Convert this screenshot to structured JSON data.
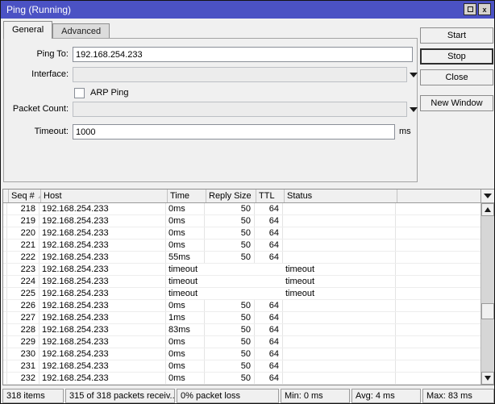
{
  "colors": {
    "titlebar_bg": "#4b52c4",
    "titlebar_text": "#ffffff",
    "window_bg": "#f0f0f0"
  },
  "titlebar": {
    "title": "Ping (Running)"
  },
  "tabs": {
    "general": "General",
    "advanced": "Advanced"
  },
  "form": {
    "ping_to_label": "Ping To:",
    "ping_to_value": "192.168.254.233",
    "interface_label": "Interface:",
    "interface_value": "",
    "arp_ping_label": "ARP Ping",
    "arp_ping_checked": false,
    "packet_count_label": "Packet Count:",
    "packet_count_value": "",
    "timeout_label": "Timeout:",
    "timeout_value": "1000",
    "timeout_unit": "ms"
  },
  "actions": {
    "start": "Start",
    "stop": "Stop",
    "close": "Close",
    "new_window": "New Window"
  },
  "table": {
    "columns": {
      "seq": "Seq #",
      "host": "Host",
      "time": "Time",
      "reply_size": "Reply Size",
      "ttl": "TTL",
      "status": "Status"
    },
    "rows": [
      {
        "seq": "218",
        "host": "192.168.254.233",
        "time": "0ms",
        "reply_size": "50",
        "ttl": "64",
        "status": ""
      },
      {
        "seq": "219",
        "host": "192.168.254.233",
        "time": "0ms",
        "reply_size": "50",
        "ttl": "64",
        "status": ""
      },
      {
        "seq": "220",
        "host": "192.168.254.233",
        "time": "0ms",
        "reply_size": "50",
        "ttl": "64",
        "status": ""
      },
      {
        "seq": "221",
        "host": "192.168.254.233",
        "time": "0ms",
        "reply_size": "50",
        "ttl": "64",
        "status": ""
      },
      {
        "seq": "222",
        "host": "192.168.254.233",
        "time": "55ms",
        "reply_size": "50",
        "ttl": "64",
        "status": ""
      },
      {
        "seq": "223",
        "host": "192.168.254.233",
        "time": "timeout",
        "reply_size": "",
        "ttl": "",
        "status": "timeout"
      },
      {
        "seq": "224",
        "host": "192.168.254.233",
        "time": "timeout",
        "reply_size": "",
        "ttl": "",
        "status": "timeout"
      },
      {
        "seq": "225",
        "host": "192.168.254.233",
        "time": "timeout",
        "reply_size": "",
        "ttl": "",
        "status": "timeout"
      },
      {
        "seq": "226",
        "host": "192.168.254.233",
        "time": "0ms",
        "reply_size": "50",
        "ttl": "64",
        "status": ""
      },
      {
        "seq": "227",
        "host": "192.168.254.233",
        "time": "1ms",
        "reply_size": "50",
        "ttl": "64",
        "status": ""
      },
      {
        "seq": "228",
        "host": "192.168.254.233",
        "time": "83ms",
        "reply_size": "50",
        "ttl": "64",
        "status": ""
      },
      {
        "seq": "229",
        "host": "192.168.254.233",
        "time": "0ms",
        "reply_size": "50",
        "ttl": "64",
        "status": ""
      },
      {
        "seq": "230",
        "host": "192.168.254.233",
        "time": "0ms",
        "reply_size": "50",
        "ttl": "64",
        "status": ""
      },
      {
        "seq": "231",
        "host": "192.168.254.233",
        "time": "0ms",
        "reply_size": "50",
        "ttl": "64",
        "status": ""
      },
      {
        "seq": "232",
        "host": "192.168.254.233",
        "time": "0ms",
        "reply_size": "50",
        "ttl": "64",
        "status": ""
      }
    ]
  },
  "statusbar": {
    "items": "318 items",
    "received": "315 of 318 packets receiv...",
    "packet_loss": "0% packet loss",
    "min": "Min: 0 ms",
    "avg": "Avg: 4 ms",
    "max": "Max: 83 ms"
  }
}
